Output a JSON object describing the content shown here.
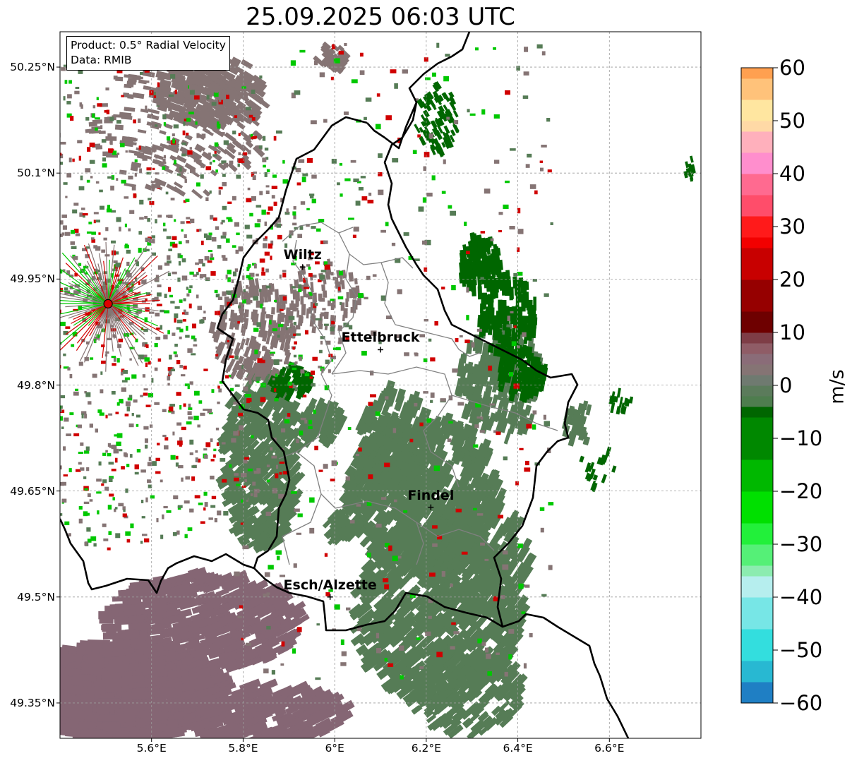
{
  "title": "25.09.2025 06:03 UTC",
  "info": {
    "product": "Product: 0.5° Radial Velocity",
    "data": "Data: RMIB"
  },
  "axes": {
    "lat_ticks": [
      {
        "value": 50.25,
        "label": "50.25°N"
      },
      {
        "value": 50.1,
        "label": "50.1°N"
      },
      {
        "value": 49.95,
        "label": "49.95°N"
      },
      {
        "value": 49.8,
        "label": "49.8°N"
      },
      {
        "value": 49.65,
        "label": "49.65°N"
      },
      {
        "value": 49.5,
        "label": "49.5°N"
      },
      {
        "value": 49.35,
        "label": "49.35°N"
      }
    ],
    "lon_ticks": [
      {
        "value": 5.6,
        "label": "5.6°E"
      },
      {
        "value": 5.8,
        "label": "5.8°E"
      },
      {
        "value": 6.0,
        "label": "6°E"
      },
      {
        "value": 6.2,
        "label": "6.2°E"
      },
      {
        "value": 6.4,
        "label": "6.4°E"
      },
      {
        "value": 6.6,
        "label": "6.6°E"
      }
    ],
    "lon_range": [
      5.4,
      6.8
    ],
    "lat_range": [
      49.3,
      50.3
    ],
    "grid": true
  },
  "cities": [
    {
      "name": "Wiltz",
      "lon": 5.93,
      "lat": 49.967
    },
    {
      "name": "Ettelbruck",
      "lon": 6.1,
      "lat": 49.85
    },
    {
      "name": "Findel",
      "lon": 6.21,
      "lat": 49.627
    },
    {
      "name": "Esch/Alzette",
      "lon": 5.99,
      "lat": 49.5
    }
  ],
  "radar_site": {
    "lon": 5.505,
    "lat": 49.915
  },
  "colorbar": {
    "label": "m/s",
    "min": -60,
    "max": 60,
    "ticks": [
      {
        "value": 60,
        "label": "60"
      },
      {
        "value": 50,
        "label": "50"
      },
      {
        "value": 40,
        "label": "40"
      },
      {
        "value": 30,
        "label": "30"
      },
      {
        "value": 20,
        "label": "20"
      },
      {
        "value": 10,
        "label": "10"
      },
      {
        "value": 0,
        "label": "0"
      },
      {
        "value": -10,
        "label": "−10"
      },
      {
        "value": -20,
        "label": "−20"
      },
      {
        "value": -30,
        "label": "−30"
      },
      {
        "value": -40,
        "label": "−40"
      },
      {
        "value": -50,
        "label": "−50"
      },
      {
        "value": -60,
        "label": "−60"
      }
    ],
    "stops": [
      {
        "from": -60,
        "to": -56,
        "color": "#1f7fc4"
      },
      {
        "from": -56,
        "to": -52,
        "color": "#28b8d2"
      },
      {
        "from": -52,
        "to": -46,
        "color": "#33dede"
      },
      {
        "from": -46,
        "to": -40,
        "color": "#77e6e6"
      },
      {
        "from": -40,
        "to": -36,
        "color": "#b6eeee"
      },
      {
        "from": -36,
        "to": -34,
        "color": "#8cecb0"
      },
      {
        "from": -34,
        "to": -30,
        "color": "#55f077"
      },
      {
        "from": -30,
        "to": -26,
        "color": "#22f03a"
      },
      {
        "from": -26,
        "to": -20,
        "color": "#00e000"
      },
      {
        "from": -20,
        "to": -14,
        "color": "#00b800"
      },
      {
        "from": -14,
        "to": -6,
        "color": "#008800"
      },
      {
        "from": -6,
        "to": -4,
        "color": "#006600"
      },
      {
        "from": -4,
        "to": -2,
        "color": "#4e7d4e"
      },
      {
        "from": -2,
        "to": 0,
        "color": "#5b7b5b"
      },
      {
        "from": 0,
        "to": 2,
        "color": "#6f7a70"
      },
      {
        "from": 2,
        "to": 4,
        "color": "#857474"
      },
      {
        "from": 4,
        "to": 6,
        "color": "#8a6c78"
      },
      {
        "from": 6,
        "to": 8,
        "color": "#8f5c66"
      },
      {
        "from": 8,
        "to": 10,
        "color": "#7e3d46"
      },
      {
        "from": 10,
        "to": 14,
        "color": "#6e0000"
      },
      {
        "from": 14,
        "to": 20,
        "color": "#960000"
      },
      {
        "from": 20,
        "to": 26,
        "color": "#c80000"
      },
      {
        "from": 26,
        "to": 28,
        "color": "#f20000"
      },
      {
        "from": 28,
        "to": 32,
        "color": "#ff1a1a"
      },
      {
        "from": 32,
        "to": 36,
        "color": "#ff4d6a"
      },
      {
        "from": 36,
        "to": 40,
        "color": "#ff6a90"
      },
      {
        "from": 40,
        "to": 44,
        "color": "#ff8ecd"
      },
      {
        "from": 44,
        "to": 48,
        "color": "#ffb0bc"
      },
      {
        "from": 48,
        "to": 50,
        "color": "#ffd9a6"
      },
      {
        "from": 50,
        "to": 54,
        "color": "#ffe6a0"
      },
      {
        "from": 54,
        "to": 58,
        "color": "#ffc27a"
      },
      {
        "from": 58,
        "to": 60,
        "color": "#ffa050"
      }
    ]
  },
  "colors": {
    "inbound_dark_green": "#006600",
    "inbound_green": "#00c800",
    "near_zero_green": "#567c56",
    "near_zero_brown": "#857474",
    "near_zero_purple": "#856674",
    "outbound_red": "#d00000",
    "border": "#000000",
    "admin_border": "#808080",
    "radar_marker": "#e00000"
  }
}
